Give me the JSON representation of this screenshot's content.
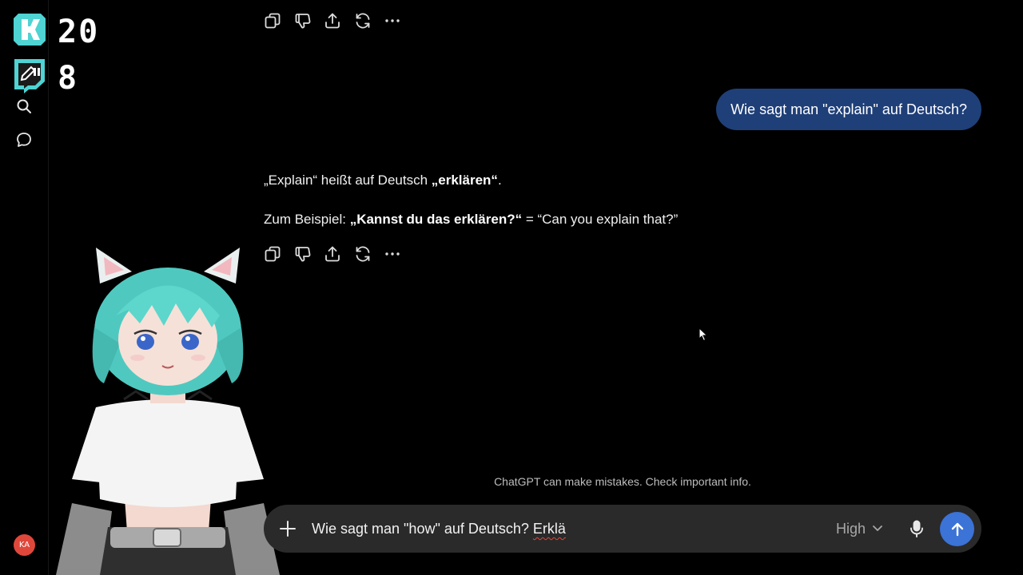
{
  "overlay": {
    "counter_line1": "20",
    "counter_line2": "8",
    "k_logo_color": "#4fd3d3",
    "twitch_icon_color": "#4fd3d3"
  },
  "sidebar": {
    "icons": [
      "search-icon",
      "chat-bubble-icon"
    ],
    "avatar_initials": "KA",
    "avatar_color": "#e0473b"
  },
  "conversation": {
    "user_message": "Wie sagt man \"explain\" auf Deutsch?",
    "assistant": {
      "line1_part1": "„Explain“ heißt auf Deutsch ",
      "line1_bold": "„erklären“",
      "line1_part2": ".",
      "line2_part1": "Zum Beispiel: ",
      "line2_bold": "„Kannst du das erklären?“",
      "line2_part2": " = “Can you explain that?”"
    },
    "actions": [
      "copy-icon",
      "thumbs-down-icon",
      "share-icon",
      "regenerate-icon",
      "more-icon"
    ]
  },
  "disclaimer": "ChatGPT can make mistakes. Check important info.",
  "composer": {
    "text_before": "Wie sagt man \"how\" auf Deutsch? ",
    "text_misspelled": "Erklä",
    "model_label": "High",
    "user_bubble_color": "#1f3f78",
    "send_button_color": "#3b73d6"
  }
}
